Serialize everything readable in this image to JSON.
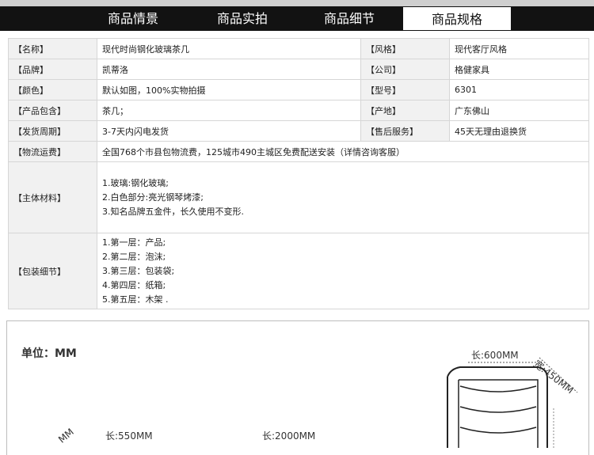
{
  "tabs": [
    {
      "label": "商品情景"
    },
    {
      "label": "商品实拍"
    },
    {
      "label": "商品细节"
    },
    {
      "label": "商品规格"
    }
  ],
  "spec": {
    "r1": {
      "k1": "【名称】",
      "v1": "现代时尚钢化玻璃茶几",
      "k2": "【风格】",
      "v2": "现代客厅风格"
    },
    "r2": {
      "k1": "【品牌】",
      "v1": "凯蒂洛",
      "k2": "【公司】",
      "v2": "格健家具"
    },
    "r3": {
      "k1": "【颜色】",
      "v1": "默认如图，100%实物拍摄",
      "k2": "【型号】",
      "v2": "6301"
    },
    "r4": {
      "k1": "【产品包含】",
      "v1": "茶几；",
      "k2": "【产地】",
      "v2": "广东佛山"
    },
    "r5": {
      "k1": "【发货周期】",
      "v1": "3-7天内闪电发货",
      "k2": "【售后服务】",
      "v2": "45天无理由退换货"
    },
    "r6": {
      "k1": "【物流运费】",
      "v1": "全国768个市县包物流费，125城市490主城区免费配送安装（详情咨询客服）"
    },
    "r7": {
      "k1": "【主体材料】",
      "lines": [
        "1.玻璃:钢化玻璃;",
        "2.白色部分:亮光钢琴烤漆;",
        "3.知名品牌五金件，长久使用不变形."
      ]
    },
    "r8": {
      "k1": "【包装细节】",
      "lines": [
        "1.第一层：产品;",
        "2.第二层：泡沫;",
        "3.第三层：包装袋;",
        "4.第四层：纸箱;",
        "5.第五层：木架 ."
      ]
    }
  },
  "dimensions": {
    "unit": "单位：MM",
    "len600": "长:600MM",
    "wid450": "宽:450MM",
    "len550": "长:550MM",
    "len2000": "长:2000MM",
    "partial": "MM"
  }
}
